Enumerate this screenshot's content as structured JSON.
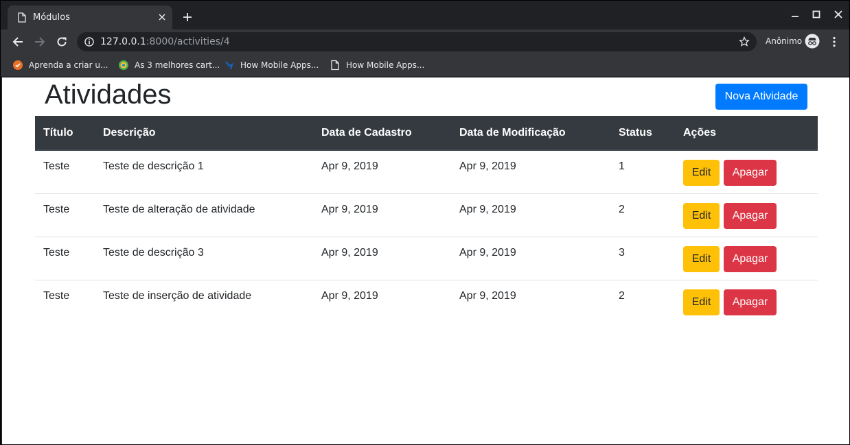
{
  "browser": {
    "tab_title": "Módulos",
    "url_host": "127.0.0.1",
    "url_rest": ":8000/activities/4",
    "profile_label": "Anônimo",
    "bookmarks": [
      {
        "label": "Aprenda a criar u...",
        "icon": "orange-site-icon"
      },
      {
        "label": "As 3 melhores cart...",
        "icon": "colorful-site-icon"
      },
      {
        "label": "How Mobile Apps...",
        "icon": "blue-site-icon"
      },
      {
        "label": "How Mobile Apps...",
        "icon": "page-icon"
      }
    ]
  },
  "page": {
    "title": "Atividades",
    "new_button": "Nova Atividade",
    "columns": [
      "Título",
      "Descrição",
      "Data de Cadastro",
      "Data de Modificação",
      "Status",
      "Ações"
    ],
    "rows": [
      {
        "titulo": "Teste",
        "descricao": "Teste de descrição 1",
        "cadastro": "Apr 9, 2019",
        "modificacao": "Apr 9, 2019",
        "status": "1"
      },
      {
        "titulo": "Teste",
        "descricao": "Teste de alteração de atividade",
        "cadastro": "Apr 9, 2019",
        "modificacao": "Apr 9, 2019",
        "status": "2"
      },
      {
        "titulo": "Teste",
        "descricao": "Teste de descrição 3",
        "cadastro": "Apr 9, 2019",
        "modificacao": "Apr 9, 2019",
        "status": "3"
      },
      {
        "titulo": "Teste",
        "descricao": "Teste de inserção de atividade",
        "cadastro": "Apr 9, 2019",
        "modificacao": "Apr 9, 2019",
        "status": "2"
      }
    ],
    "edit_label": "Edit",
    "delete_label": "Apagar"
  },
  "colors": {
    "primary": "#007bff",
    "warning": "#ffc107",
    "danger": "#dc3545",
    "table_header": "#343a40"
  }
}
